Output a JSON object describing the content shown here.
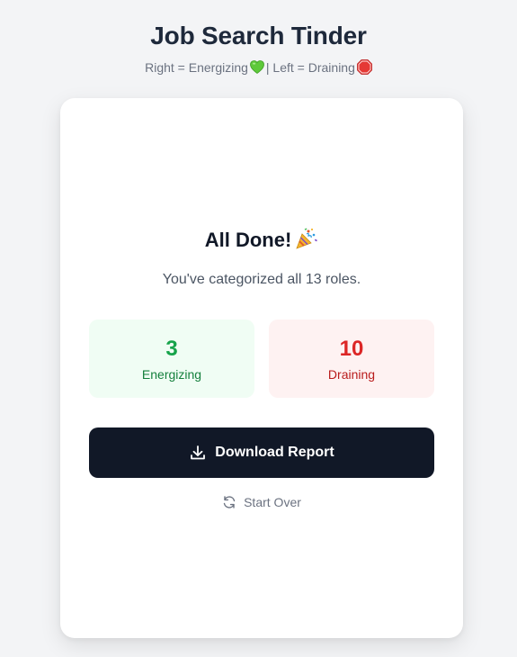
{
  "header": {
    "title": "Job Search Tinder",
    "subtitle_right": "Right = Energizing",
    "subtitle_sep": "| Left = Draining",
    "heart_emoji": "green-heart",
    "stop_emoji": "stop-sign"
  },
  "summary": {
    "title": "All Done!",
    "title_emoji": "party-popper",
    "message": "You've categorized all 13 roles."
  },
  "stats": {
    "energizing": {
      "count": "3",
      "label": "Energizing",
      "color": "#16a34a",
      "bg": "#f0fdf4"
    },
    "draining": {
      "count": "10",
      "label": "Draining",
      "color": "#dc2626",
      "bg": "#fef2f2"
    }
  },
  "actions": {
    "download_label": "Download Report",
    "download_icon": "download-icon",
    "restart_label": "Start Over",
    "restart_icon": "refresh-icon"
  },
  "colors": {
    "background": "#f3f4f6",
    "card": "#ffffff",
    "primary_button": "#111827"
  }
}
